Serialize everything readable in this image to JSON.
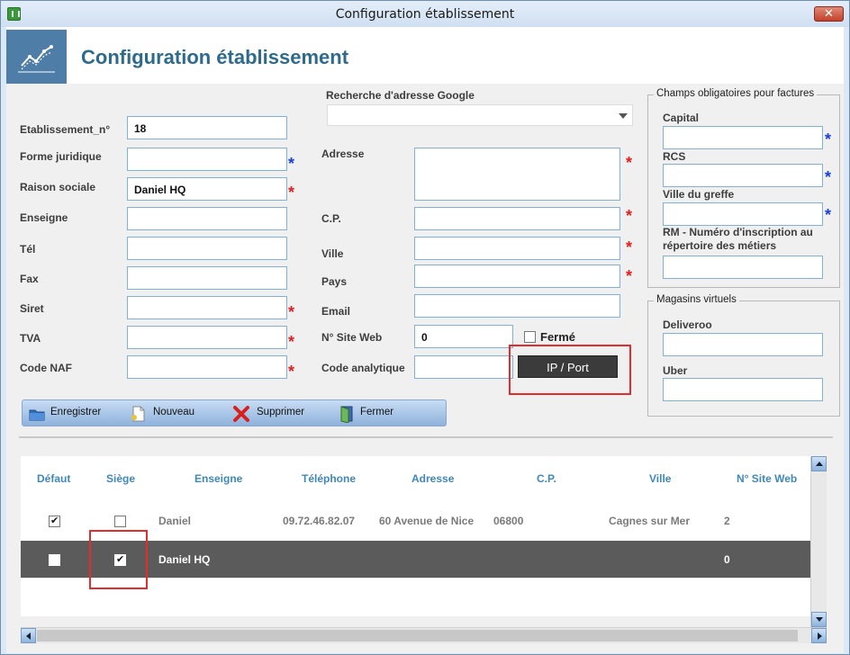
{
  "window": {
    "title": "Configuration établissement",
    "close_label": "✕"
  },
  "header": {
    "title": "Configuration établissement"
  },
  "form": {
    "etablissement_label": "Etablissement_n°",
    "etablissement_value": "18",
    "forme_label": "Forme juridique",
    "forme_value": "",
    "raison_label": "Raison sociale",
    "raison_value": "Daniel HQ",
    "enseigne_label": "Enseigne",
    "enseigne_value": "",
    "tel_label": "Tél",
    "tel_value": "",
    "fax_label": "Fax",
    "fax_value": "",
    "siret_label": "Siret",
    "siret_value": "",
    "tva_label": "TVA",
    "tva_value": "",
    "naf_label": "Code NAF",
    "naf_value": "",
    "google_label": "Recherche d'adresse Google",
    "google_value": "",
    "adresse_label": "Adresse",
    "adresse_value": "",
    "cp_label": "C.P.",
    "cp_value": "",
    "ville_label": "Ville",
    "ville_value": "",
    "pays_label": "Pays",
    "pays_value": "",
    "email_label": "Email",
    "email_value": "",
    "site_label": "N° Site Web",
    "site_value": "0",
    "analytique_label": "Code analytique",
    "analytique_value": "",
    "ferme_label": "Fermé",
    "ipport_label": "IP / Port",
    "required_mark": "*"
  },
  "factures": {
    "title": "Champs obligatoires pour factures",
    "capital_label": "Capital",
    "rcs_label": "RCS",
    "greffe_label": "Ville du greffe",
    "rm_label": "RM - Numéro d'inscription au répertoire des métiers"
  },
  "magasins": {
    "title": "Magasins virtuels",
    "deliveroo_label": "Deliveroo",
    "uber_label": "Uber"
  },
  "toolbar": {
    "save_label": "Enregistrer",
    "new_label": "Nouveau",
    "delete_label": "Supprimer",
    "close_label": "Fermer"
  },
  "table": {
    "columns": [
      "Défaut",
      "Siège",
      "Enseigne",
      "Téléphone",
      "Adresse",
      "C.P.",
      "Ville",
      "N° Site Web"
    ],
    "rows": [
      {
        "defaut": true,
        "siege": false,
        "enseigne": "Daniel",
        "telephone": "09.72.46.82.07",
        "adresse": "60 Avenue de Nice",
        "cp": "06800",
        "ville": "Cagnes sur Mer",
        "site": "2"
      },
      {
        "defaut": false,
        "siege": true,
        "enseigne": "Daniel HQ",
        "telephone": "",
        "adresse": "",
        "cp": "",
        "ville": "",
        "site": "0"
      }
    ]
  },
  "colors": {
    "header_title": "#2d6b8c",
    "column_header": "#3f88b8",
    "required_red": "#e02020",
    "required_blue": "#1a3fd6",
    "selected_row": "#5b5b5b",
    "highlight": "#e52b2b"
  },
  "icons": [
    "app-icon",
    "chart-icon",
    "folder-icon",
    "document-icon",
    "delete-x-icon",
    "door-icon"
  ]
}
